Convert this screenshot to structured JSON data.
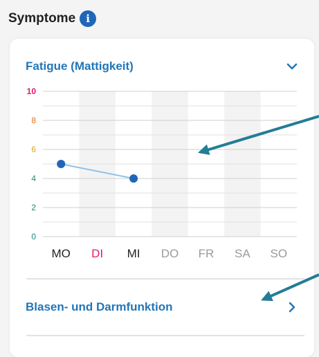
{
  "section": {
    "title": "Symptome",
    "info_icon_glyph": "i",
    "info_icon": "info-icon"
  },
  "rows": {
    "fatigue": {
      "title": "Fatigue (Mattigkeit)",
      "state": "expanded",
      "icon": "chevron-down-icon"
    },
    "blasen": {
      "title": "Blasen- und Darmfunktion",
      "state": "collapsed",
      "icon": "chevron-right-icon"
    }
  },
  "colors": {
    "accent": "#2276b8",
    "info_icon": "#1f66b8",
    "point": "#1f66b8",
    "line": "#8ec2e6",
    "arrow": "#237d95",
    "day_active": "#222222",
    "day_today": "#e0196f",
    "day_future": "#9a9a9a"
  },
  "chart_data": {
    "type": "line",
    "title": "",
    "xlabel": "",
    "ylabel": "",
    "ylim": [
      0,
      10
    ],
    "yticks": [
      0,
      2,
      4,
      6,
      8,
      10
    ],
    "ytick_colors": [
      "#1f8a7a",
      "#1f8a7a",
      "#1f8a7a",
      "#e0a21a",
      "#e07020",
      "#e0196f"
    ],
    "grid": true,
    "categories": [
      "MO",
      "DI",
      "MI",
      "DO",
      "FR",
      "SA",
      "SO"
    ],
    "category_colors": [
      "#222222",
      "#e0196f",
      "#222222",
      "#9a9a9a",
      "#9a9a9a",
      "#9a9a9a",
      "#9a9a9a"
    ],
    "series": [
      {
        "values": [
          5,
          null,
          4,
          null,
          null,
          null,
          null
        ]
      }
    ]
  }
}
